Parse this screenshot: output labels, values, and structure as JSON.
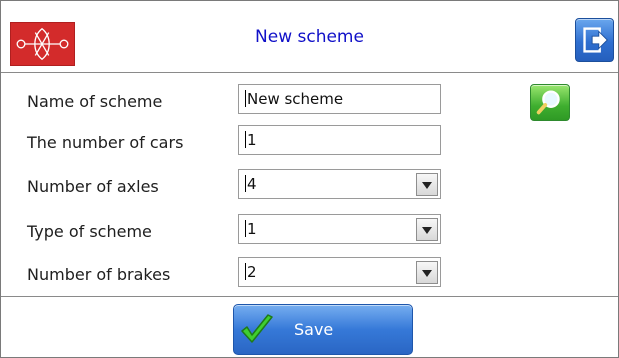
{
  "header": {
    "title": "New scheme",
    "logo_icon": "wheel-axle-logo-icon",
    "exit_icon": "exit-icon"
  },
  "form": {
    "fields": [
      {
        "label": "Name of scheme",
        "value": "New scheme",
        "type": "text"
      },
      {
        "label": "The number of cars",
        "value": "1",
        "type": "text"
      },
      {
        "label": "Number of axles",
        "value": "4",
        "type": "select"
      },
      {
        "label": "Type of scheme",
        "value": "1",
        "type": "select"
      },
      {
        "label": "Number of brakes",
        "value": "2",
        "type": "select"
      }
    ],
    "search_icon": "magnifier-icon"
  },
  "footer": {
    "save_label": "Save",
    "save_icon": "checkmark-icon"
  },
  "colors": {
    "logo_bg": "#d32b2b",
    "title_text": "#1010c8",
    "button_blue": "#3679d8",
    "button_green": "#3fae2f"
  }
}
